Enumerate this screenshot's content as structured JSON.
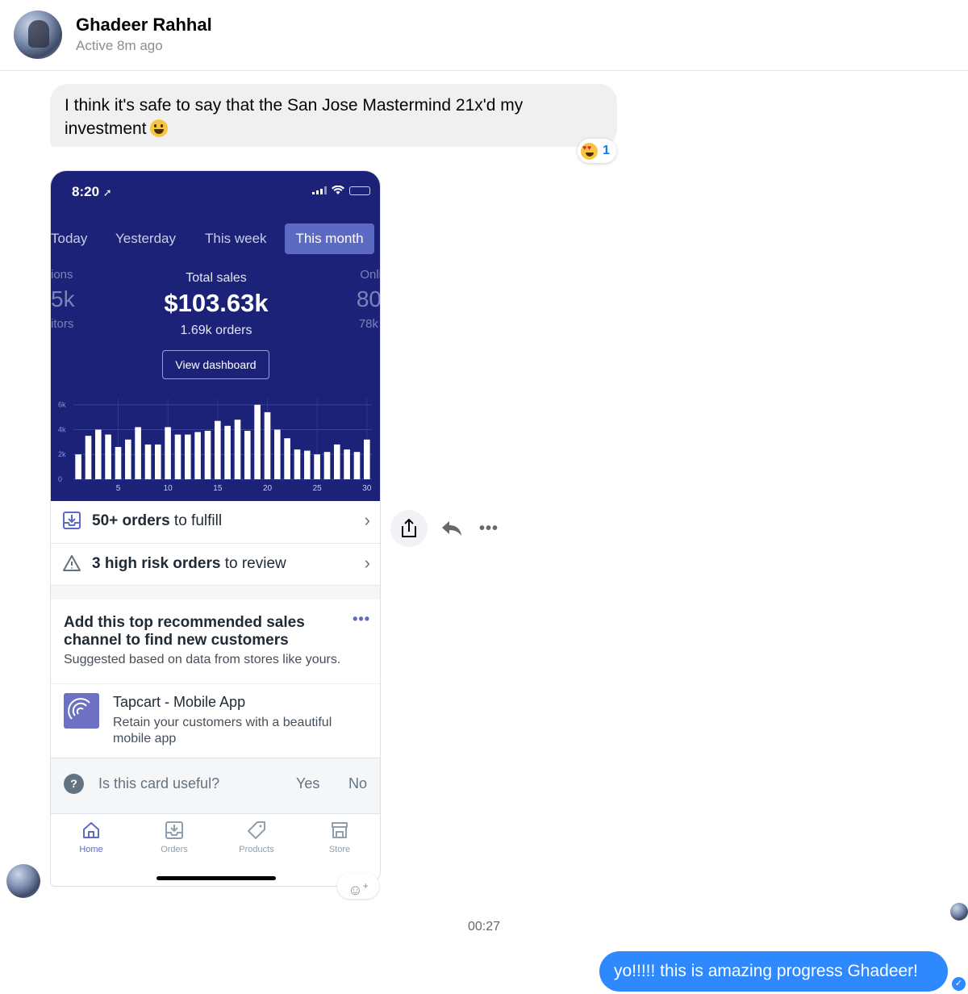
{
  "header": {
    "contact_name": "Ghadeer Rahhal",
    "status": "Active 8m ago"
  },
  "messages": {
    "incoming_text_1": "I think it's safe to say that the San Jose Mastermind 21x'd my investment",
    "incoming_text_1_reaction_count": "1",
    "timestamp": "00:27",
    "outgoing_text_1": "yo!!!!! this is amazing progress Ghadeer!"
  },
  "screenshot": {
    "status_time": "8:20",
    "tabs": [
      "Today",
      "Yesterday",
      "This week",
      "This month"
    ],
    "active_tab": "This month",
    "left_stat": {
      "label": "ions",
      "value": "5k",
      "sub": "itors"
    },
    "right_stat": {
      "label": "Onli",
      "value": "80",
      "sub": "78k"
    },
    "total_label": "Total sales",
    "total_value": "$103.63k",
    "total_orders": "1.69k orders",
    "view_dashboard": "View dashboard",
    "row_fulfill_bold": "50+ orders",
    "row_fulfill_rest": " to fulfill",
    "row_risk_bold": "3 high risk orders",
    "row_risk_rest": " to review",
    "card_title": "Add this top recommended sales channel to find new customers",
    "card_subtitle": "Suggested based on data from stores like yours.",
    "app_name": "Tapcart - Mobile App",
    "app_desc": "Retain your customers with a beautiful mobile app",
    "useful_question": "Is this card useful?",
    "useful_yes": "Yes",
    "useful_no": "No",
    "tabbar": [
      "Home",
      "Orders",
      "Products",
      "Store"
    ]
  },
  "chart_data": {
    "type": "bar",
    "x": [
      1,
      2,
      3,
      4,
      5,
      6,
      7,
      8,
      9,
      10,
      11,
      12,
      13,
      14,
      15,
      16,
      17,
      18,
      19,
      20,
      21,
      22,
      23,
      24,
      25,
      26,
      27,
      28,
      29,
      30
    ],
    "values": [
      2.0,
      3.5,
      4.0,
      3.6,
      2.6,
      3.2,
      4.2,
      2.8,
      2.8,
      4.2,
      3.6,
      3.6,
      3.8,
      3.9,
      4.7,
      4.3,
      4.8,
      3.9,
      6.0,
      5.4,
      4.0,
      3.3,
      2.4,
      2.3,
      2.0,
      2.2,
      2.8,
      2.4,
      2.2,
      3.2
    ],
    "xticks": [
      "5",
      "10",
      "15",
      "20",
      "25",
      "30"
    ],
    "yticks": [
      "0",
      "2k",
      "4k",
      "6k"
    ],
    "ylim": [
      0,
      6.5
    ],
    "grid": true
  },
  "colors": {
    "dashboard_bg": "#1b2277",
    "accent": "#5c6ac4",
    "messenger_blue": "#2e89ff"
  }
}
